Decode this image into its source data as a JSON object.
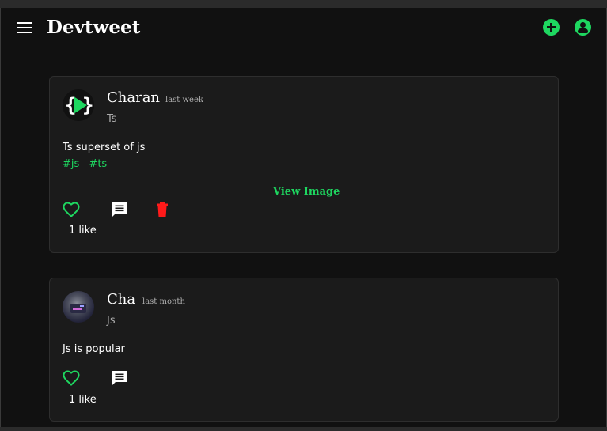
{
  "app": {
    "title": "Devtweet"
  },
  "colors": {
    "accent": "#1ed760",
    "danger": "#ff1a1a",
    "background": "#111111",
    "card": "#1b1b1b"
  },
  "header": {
    "menu_icon": "menu-icon",
    "add_icon": "add-circle-icon",
    "account_icon": "account-circle-icon"
  },
  "posts": [
    {
      "author": "Charan",
      "time": "last week",
      "title": "Ts",
      "body": "Ts superset of js",
      "tags": [
        "#js",
        "#ts"
      ],
      "view_image_label": "View Image",
      "likes": "1 like"
    },
    {
      "author": "Cha",
      "time": "last month",
      "title": "Js",
      "body": "Js is popular",
      "likes": "1 like"
    }
  ]
}
